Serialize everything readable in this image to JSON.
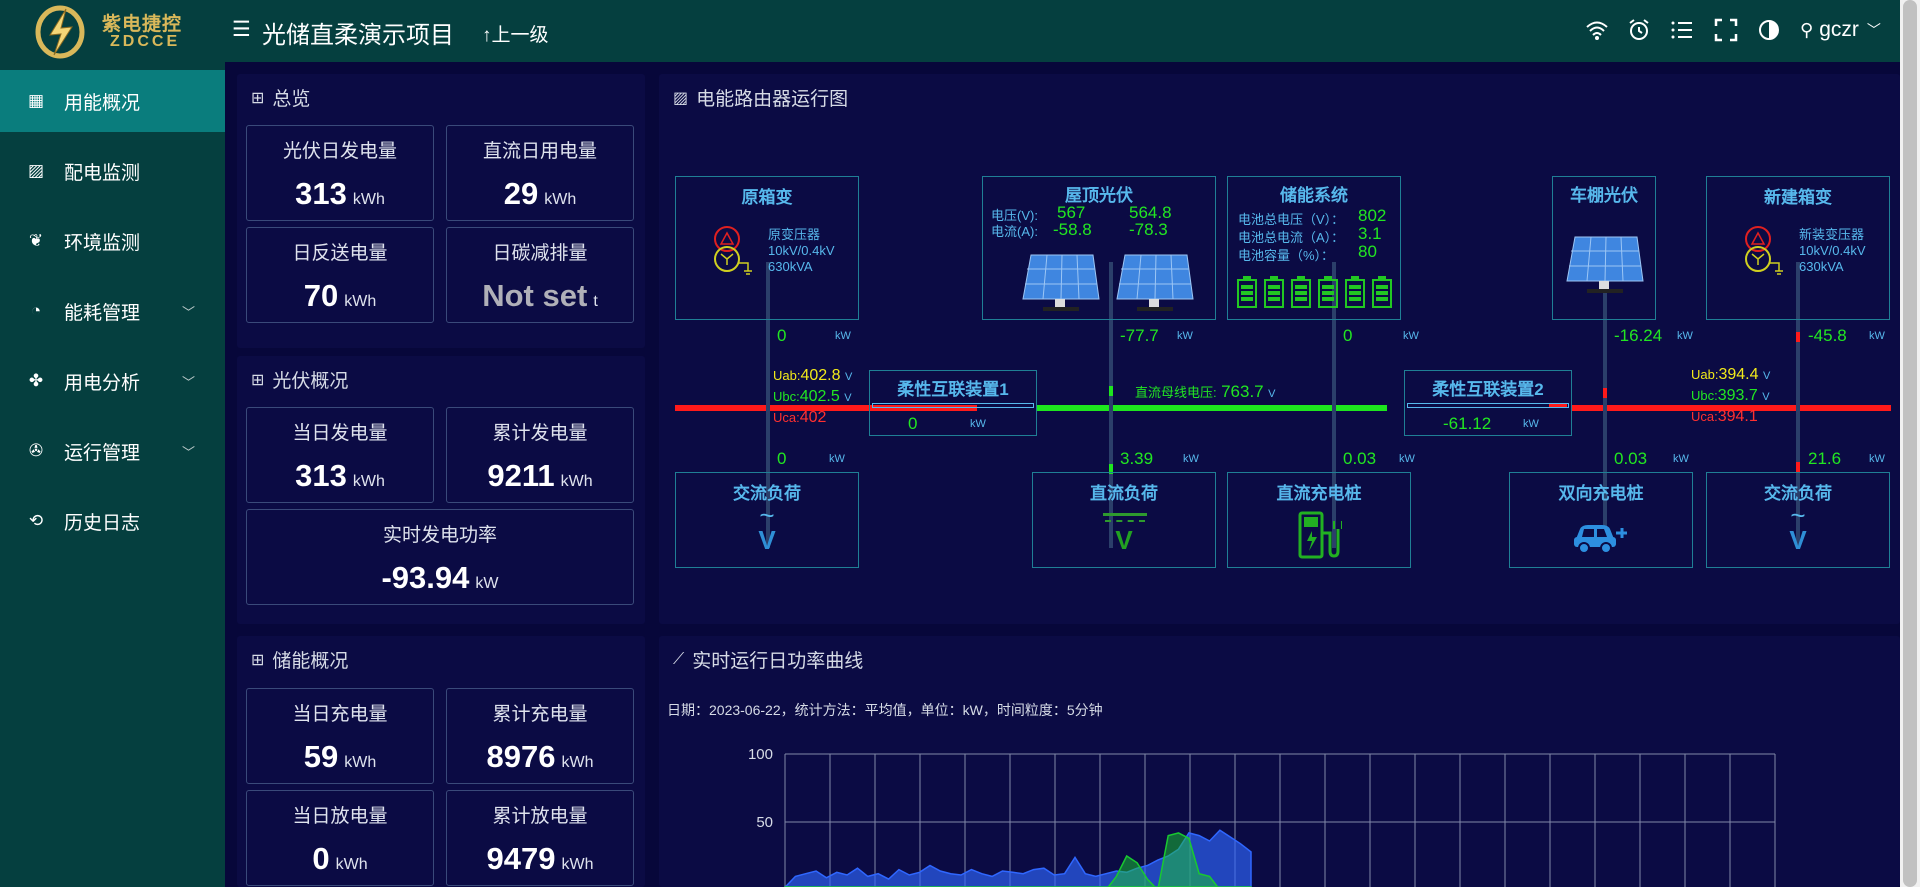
{
  "app": {
    "logo_cn": "紫电捷控",
    "logo_en": "ZDCCE",
    "project_title": "光储直柔演示项目",
    "up_label": "上一级",
    "username": "gczr"
  },
  "sidebar": {
    "items": [
      {
        "label": "用能概况",
        "icon": "dashboard-icon",
        "active": true,
        "expandable": false
      },
      {
        "label": "配电监测",
        "icon": "image-icon",
        "active": false,
        "expandable": false
      },
      {
        "label": "环境监测",
        "icon": "leaf-icon",
        "active": false,
        "expandable": false
      },
      {
        "label": "能耗管理",
        "icon": "pie-icon",
        "active": false,
        "expandable": true
      },
      {
        "label": "用电分析",
        "icon": "apps-icon",
        "active": false,
        "expandable": true
      },
      {
        "label": "运行管理",
        "icon": "aperture-icon",
        "active": false,
        "expandable": true
      },
      {
        "label": "历史日志",
        "icon": "history-icon",
        "active": false,
        "expandable": false
      }
    ]
  },
  "overview": {
    "title": "总览",
    "cards": [
      {
        "label": "光伏日发电量",
        "value": "313",
        "unit": "kWh"
      },
      {
        "label": "直流日用电量",
        "value": "29",
        "unit": "kWh"
      },
      {
        "label": "日反送电量",
        "value": "70",
        "unit": "kWh"
      },
      {
        "label": "日碳减排量",
        "value": "Not set",
        "unit": "t"
      }
    ]
  },
  "pv": {
    "title": "光伏概况",
    "cards": [
      {
        "label": "当日发电量",
        "value": "313",
        "unit": "kWh"
      },
      {
        "label": "累计发电量",
        "value": "9211",
        "unit": "kWh"
      }
    ],
    "power": {
      "label": "实时发电功率",
      "value": "-93.94",
      "unit": "kW"
    }
  },
  "storage": {
    "title": "储能概况",
    "cards": [
      {
        "label": "当日充电量",
        "value": "59",
        "unit": "kWh"
      },
      {
        "label": "累计充电量",
        "value": "8976",
        "unit": "kWh"
      },
      {
        "label": "当日放电量",
        "value": "0",
        "unit": "kWh"
      },
      {
        "label": "累计放电量",
        "value": "9479",
        "unit": "kWh"
      }
    ]
  },
  "diagram": {
    "title": "电能路由器运行图",
    "transformer1": {
      "title": "原箱变",
      "line1": "原变压器",
      "line2": "10kV/0.4kV",
      "line3": "630kVA"
    },
    "pv_roof": {
      "title": "屋顶光伏",
      "v_label": "电压(V):",
      "i_label": "电流(A):",
      "v1": "567",
      "v2": "564.8",
      "i1": "-58.8",
      "i2": "-78.3"
    },
    "storage": {
      "title": "储能系统",
      "bv_label": "电池总电压（V）：",
      "bv": "802",
      "bi_label": "电池总电流（A）：",
      "bi": "3.1",
      "bs_label": "电池容量（%）：",
      "bs": "80"
    },
    "carport_pv": {
      "title": "车棚光伏"
    },
    "transformer2": {
      "title": "新建箱变",
      "line1": "新装变压器",
      "line2": "10kV/0.4kV",
      "line3": "630kVA"
    },
    "flex1": {
      "title": "柔性互联装置1",
      "value": "0",
      "unit": "kW"
    },
    "flex2": {
      "title": "柔性互联装置2",
      "value": "-61.12",
      "unit": "kW"
    },
    "bus_voltage": {
      "label": "直流母线电压:",
      "value": "763.7",
      "unit": "V"
    },
    "left_voltage": {
      "uab_label": "Uab:",
      "uab": "402.8",
      "ubc_label": "Ubc:",
      "ubc": "402.5",
      "uca_label": "Uca:",
      "uca": "402",
      "unit": "V"
    },
    "right_voltage": {
      "uab_label": "Uab:",
      "uab": "394.4",
      "ubc_label": "Ubc:",
      "ubc": "393.7",
      "uca_label": "Uca:",
      "uca": "394.1",
      "unit": "V"
    },
    "flows": {
      "t1_top": "0",
      "pv_top": "-77.7",
      "st_top": "0",
      "cp_top": "-16.24",
      "t2_top": "-45.8",
      "ac1_bottom": "0",
      "dcload_bottom": "3.39",
      "dcch_bottom": "0.03",
      "bich_bottom": "0.03",
      "ac2_bottom": "21.6",
      "unit": "kW"
    },
    "loads": {
      "ac_load1": "交流负荷",
      "dc_load": "直流负荷",
      "dc_charger": "直流充电桩",
      "bi_charger": "双向充电桩",
      "ac_load2": "交流负荷"
    },
    "load_symbols": {
      "ac": "V",
      "dc": "V"
    }
  },
  "curve": {
    "title": "实时运行日功率曲线",
    "subtitle": "日期：2023-06-22，统计方法：平均值，单位：kW，时间粒度：5分钟"
  },
  "chart_data": {
    "type": "area",
    "yticks": [
      "100",
      "50"
    ],
    "ylim": [
      -100,
      100
    ],
    "series": [
      {
        "color": "#2f67ff",
        "values": [
          2,
          10,
          12,
          14,
          9,
          13,
          11,
          16,
          10,
          12,
          8,
          15,
          11,
          13,
          18,
          14,
          12,
          11,
          15,
          12,
          10,
          14,
          13,
          12,
          15,
          16,
          11,
          12,
          24,
          12,
          10,
          12,
          14,
          13,
          16,
          18,
          22,
          25,
          30,
          42,
          40,
          36,
          44,
          39,
          34,
          28
        ]
      },
      {
        "color": "#19c930",
        "values": [
          0,
          0,
          0,
          0,
          0,
          0,
          0,
          0,
          0,
          0,
          0,
          0,
          0,
          0,
          0,
          0,
          0,
          0,
          0,
          0,
          0,
          0,
          0,
          0,
          0,
          0,
          0,
          0,
          0,
          0,
          0,
          0,
          10,
          25,
          20,
          8,
          0,
          40,
          42,
          38,
          12,
          10,
          0,
          0,
          0,
          0
        ]
      }
    ]
  }
}
